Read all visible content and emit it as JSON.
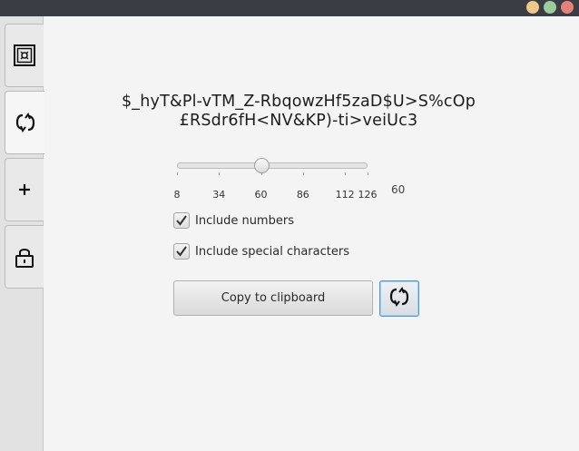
{
  "window": {
    "controls": [
      "minimize",
      "maximize",
      "close"
    ]
  },
  "sidebar": {
    "tabs": [
      {
        "id": "vault",
        "icon": "safe-icon",
        "active": false
      },
      {
        "id": "generator",
        "icon": "refresh-icon",
        "active": true
      },
      {
        "id": "add",
        "icon": "plus-icon",
        "active": false
      },
      {
        "id": "lock",
        "icon": "lock-icon",
        "active": false
      }
    ]
  },
  "generator": {
    "password_line1": "$_hyT&Pl-vTM_Z-RbqowzHf5zaD$U>S%cOp",
    "password_line2": "£RSdr6fH<NV&KP)-ti>veiUc3",
    "length_slider": {
      "min": 8,
      "max": 126,
      "value": 60,
      "tick_labels": [
        "8",
        "34",
        "60",
        "86",
        "112",
        "126"
      ],
      "value_label": "60"
    },
    "options": [
      {
        "label": "Include numbers",
        "checked": true
      },
      {
        "label": "Include special characters",
        "checked": true
      }
    ],
    "copy_button_label": "Copy to clipboard",
    "refresh_button_icon": "refresh-icon"
  }
}
